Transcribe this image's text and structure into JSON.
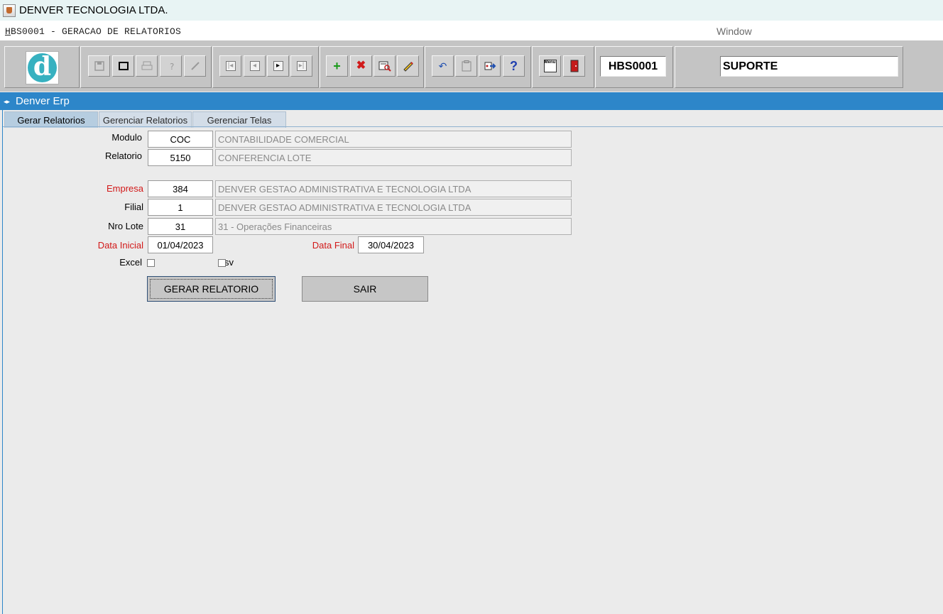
{
  "titlebar": {
    "title": "DENVER TECNOLOGIA LTDA."
  },
  "menubar": {
    "form_title_first": "H",
    "form_title_rest": "BS0001 - GERACAO DE RELATORIOS",
    "window_menu": "Window"
  },
  "toolbar": {
    "logo_letter": "d",
    "form_code": "HBS0001",
    "user": "SUPORTE",
    "help_glyph": "?",
    "menu_glyph": "Menu"
  },
  "window": {
    "title": "Denver Erp"
  },
  "tabs": [
    {
      "label": "Gerar Relatorios"
    },
    {
      "label": "Gerenciar Relatorios"
    },
    {
      "label": "Gerenciar Telas"
    }
  ],
  "form": {
    "modulo": {
      "label": "Modulo",
      "code": "COC",
      "desc": "CONTABILIDADE COMERCIAL"
    },
    "relatorio": {
      "label": "Relatorio",
      "code": "5150",
      "desc": "CONFERENCIA LOTE"
    },
    "empresa": {
      "label": "Empresa",
      "code": "384",
      "desc": "DENVER GESTAO ADMINISTRATIVA E TECNOLOGIA LTDA"
    },
    "filial": {
      "label": "Filial",
      "code": "1",
      "desc": "DENVER GESTAO ADMINISTRATIVA E TECNOLOGIA LTDA"
    },
    "lote": {
      "label": "Nro Lote",
      "code": "31",
      "desc": "31 - Operações Financeiras"
    },
    "data_inicial": {
      "label": "Data Inicial",
      "value": "01/04/2023"
    },
    "data_final": {
      "label": "Data Final",
      "value": "30/04/2023"
    },
    "excel": {
      "label": "Excel",
      "checked": false
    },
    "csv": {
      "label": "Csv",
      "checked": false
    },
    "generate_button": "GERAR RELATORIO",
    "exit_button": "SAIR"
  },
  "colors": {
    "header_blue": "#2d86c9",
    "required_red": "#d21919",
    "logo_teal": "#37b1c0"
  }
}
